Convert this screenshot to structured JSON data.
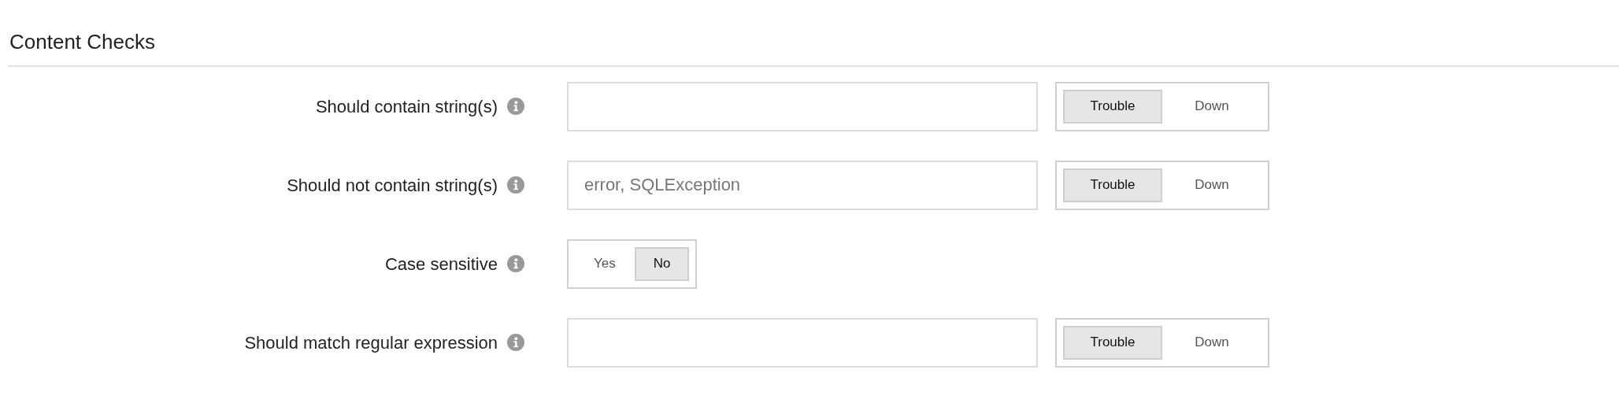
{
  "section": {
    "title": "Content Checks"
  },
  "rows": [
    {
      "kind": "text",
      "label": "Should contain string(s)",
      "options": [
        {
          "label": "Trouble",
          "selected": true
        },
        {
          "label": "Down",
          "selected": false
        }
      ]
    },
    {
      "kind": "text",
      "label": "Should not contain string(s)",
      "placeholder": "error, SQLException",
      "options": [
        {
          "label": "Trouble",
          "selected": true
        },
        {
          "label": "Down",
          "selected": false
        }
      ]
    },
    {
      "kind": "choice",
      "label": "Case sensitive",
      "options": [
        {
          "label": "Yes",
          "selected": false
        },
        {
          "label": "No",
          "selected": true
        }
      ]
    },
    {
      "kind": "text",
      "label": "Should match regular expression",
      "options": [
        {
          "label": "Trouble",
          "selected": true
        },
        {
          "label": "Down",
          "selected": false
        }
      ]
    }
  ]
}
